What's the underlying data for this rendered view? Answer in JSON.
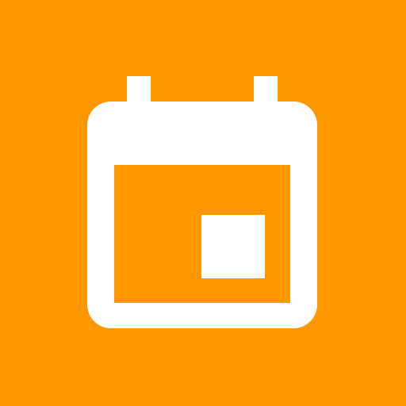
{
  "app_icon": {
    "icon": "calendar-event-icon",
    "background_color": "#FF9800",
    "glyph_color": "#FFFFFF"
  }
}
